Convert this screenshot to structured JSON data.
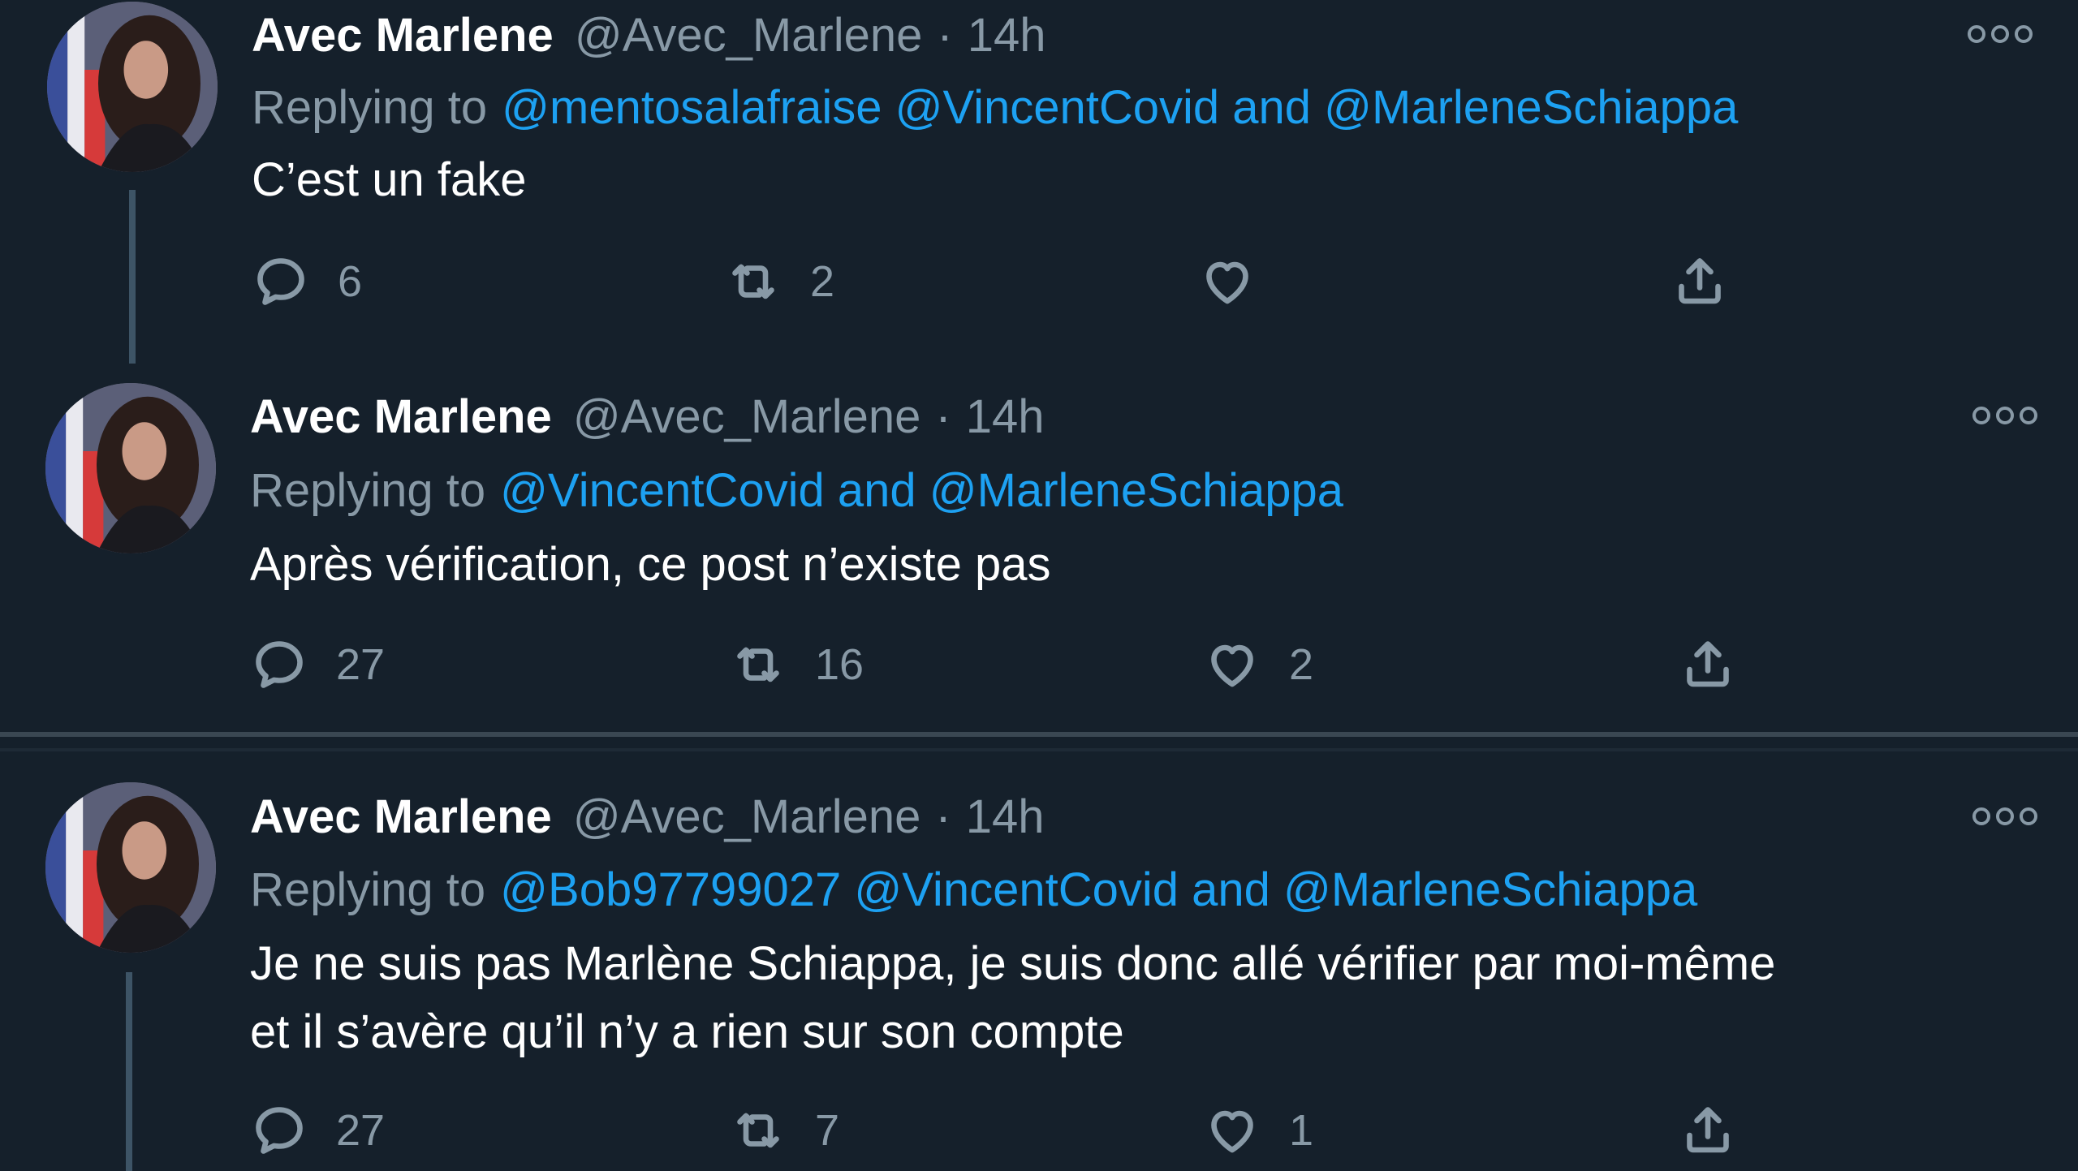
{
  "colors": {
    "background": "#15202b",
    "text": "#ffffff",
    "muted": "#8899a6",
    "mention": "#1da1f2",
    "thread_line": "#3d5466",
    "separator": "#3a4752"
  },
  "icons": {
    "reply": "speech-bubble-icon",
    "retweet": "retweet-icon",
    "like": "heart-icon",
    "share": "share-upload-icon",
    "more": "more-dots-icon"
  },
  "tweets": [
    {
      "display_name": "Avec Marlene",
      "handle": "@Avec_Marlene",
      "separator": "·",
      "time": "14h",
      "replying_prefix": "Replying to",
      "mentions_text": "@mentosalafraise @VincentCovid and @MarleneSchiappa",
      "text": "C’est un fake",
      "replies": "6",
      "retweets": "2",
      "likes": ""
    },
    {
      "display_name": "Avec Marlene",
      "handle": "@Avec_Marlene",
      "separator": "·",
      "time": "14h",
      "replying_prefix": "Replying to",
      "mentions_text": "@VincentCovid and @MarleneSchiappa",
      "text": "Après vérification, ce post n’existe pas",
      "replies": "27",
      "retweets": "16",
      "likes": "2"
    },
    {
      "display_name": "Avec Marlene",
      "handle": "@Avec_Marlene",
      "separator": "·",
      "time": "14h",
      "replying_prefix": "Replying to",
      "mentions_text": "@Bob97799027 @VincentCovid and @MarleneSchiappa",
      "text": "Je ne suis pas Marlène Schiappa, je suis donc allé vérifier par moi-même\net il s’avère qu’il n’y a rien sur son compte",
      "replies": "27",
      "retweets": "7",
      "likes": "1"
    }
  ]
}
